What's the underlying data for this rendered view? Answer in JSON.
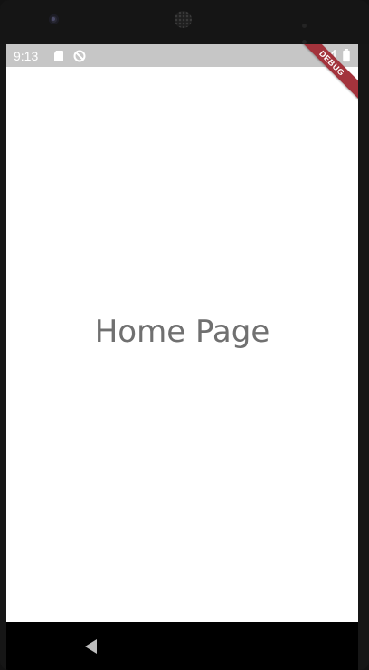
{
  "status_bar": {
    "time": "9:13",
    "icons": [
      "sd-card-icon",
      "sync-icon",
      "signal-icon",
      "battery-icon"
    ]
  },
  "debug_banner": {
    "label": "DEBUG",
    "color": "#a3333c"
  },
  "page": {
    "title": "Home Page"
  },
  "nav_bar": {
    "icons": [
      "back-icon"
    ]
  },
  "colors": {
    "status_bar_bg": "#c6c6c6",
    "screen_bg": "#ffffff",
    "title_text": "#707070",
    "nav_bar_bg": "#000000"
  }
}
